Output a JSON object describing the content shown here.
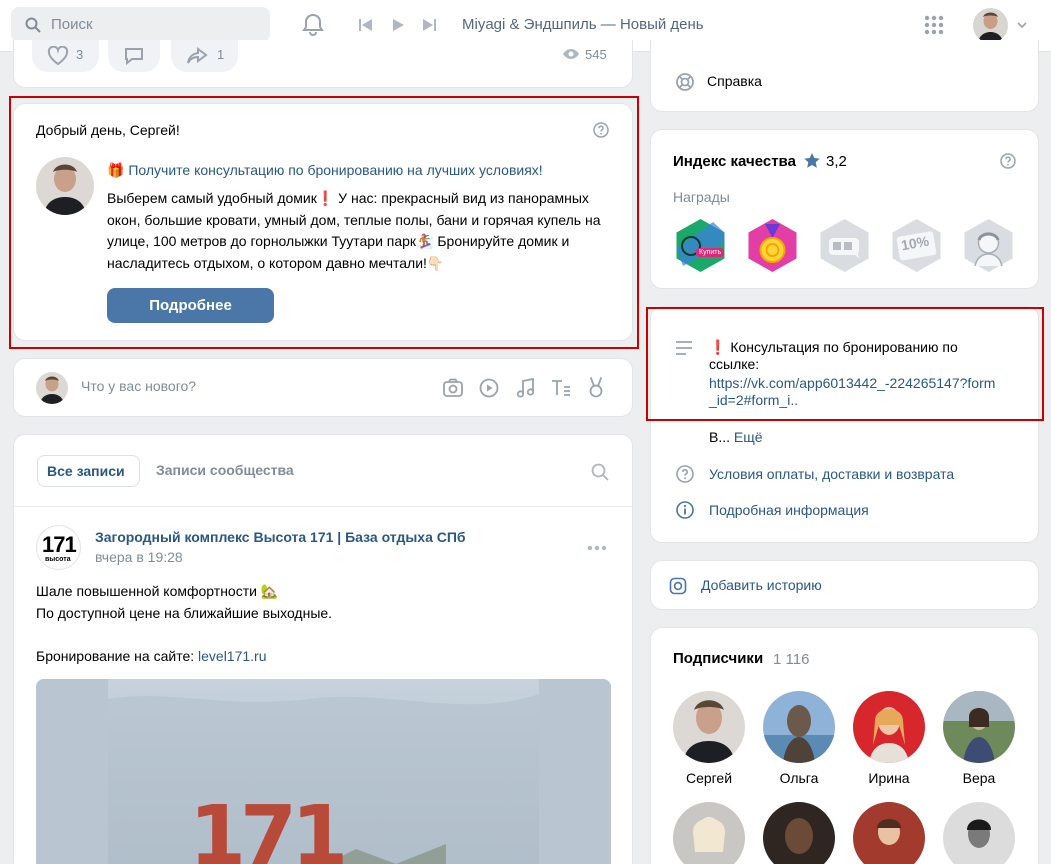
{
  "topbar": {
    "search_placeholder": "Поиск",
    "now_playing": "Miyagi & Эндшпиль — Новый день",
    "icons": [
      "search-icon",
      "bell-icon",
      "prev-icon",
      "play-icon",
      "next-icon",
      "apps-grid-icon",
      "chevron-down-icon"
    ]
  },
  "post_actions": {
    "likes": "3",
    "reposts": "1",
    "views": "545"
  },
  "promo": {
    "greeting": "Добрый день, Сергей!",
    "headline": "🎁 Получите консультацию по бронированию на лучших условиях!",
    "body": "Выберем самый удобный домик❗ У нас: прекрасный вид из панорамных окон, большие кровати, умный дом, теплые полы, бани и горячая купель на улице, 100 метров до горнолыжки Туутари парк🏂 Бронируйте домик и насладитесь отдыхом, о котором давно мечтали!👇🏻",
    "button": "Подробнее"
  },
  "composer": {
    "placeholder": "Что у вас нового?"
  },
  "wall": {
    "tab_all": "Все записи",
    "tab_community": "Записи сообщества"
  },
  "post": {
    "author": "Загородный комплекс Высота 171 | База отдыха СПб",
    "time": "вчера в 19:28",
    "logo_text": "171",
    "logo_sub": "высота",
    "line1": "Шале повышенной комфортности 🏡",
    "line2": "По доступной цене на ближайшие выходные.",
    "booking_prefix": "Бронирование на сайте: ",
    "booking_link": "level171.ru",
    "image_text": "171"
  },
  "sidebar": {
    "help": "Справка",
    "quality_title": "Индекс качества",
    "quality_value": "3,2",
    "awards_label": "Награды",
    "award_buy": "Купить",
    "award_percent": "10%",
    "info_text": "❗ Консультация по бронированию по ссылке:",
    "info_link": "https://vk.com/app6013442_-224265147?form_id=2#form_i..",
    "info_more_prefix": "В...",
    "info_more": "Ещё",
    "payment_terms": "Условия оплаты, доставки и возврата",
    "details": "Подробная информация",
    "add_story": "Добавить историю",
    "subscribers_title": "Подписчики",
    "subscribers_count": "1 116",
    "subscribers": [
      "Сергей",
      "Ольга",
      "Ирина",
      "Вера"
    ]
  },
  "colors": {
    "accent": "#4a76a8",
    "link": "#2a5885",
    "highlight": "#cc0000",
    "background": "#edeef0"
  }
}
